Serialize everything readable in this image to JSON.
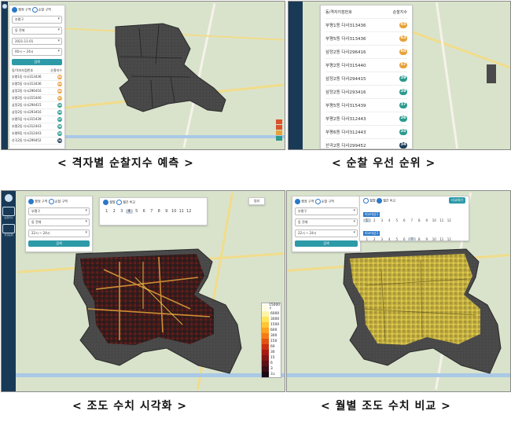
{
  "captions": {
    "top_left": "< 격자별 순찰지수 예측 >",
    "top_right": "< 순찰 우선 순위 >",
    "bottom_left": "< 조도 수치 시각화 >",
    "bottom_right": "< 월별 조도 수치 비교 >"
  },
  "sidebar": {
    "items": [
      {
        "icon": "bell-icon",
        "label": "순찰지수"
      },
      {
        "icon": "edit-icon",
        "label": "우선순위"
      }
    ]
  },
  "panel1": {
    "radio_admin": "행정 구역",
    "radio_patrol": "순찰 구역",
    "select_district": "부평구",
    "select_dong": "동 전체",
    "select_date": "2021-11-01",
    "select_time": "00시 ~ 24시",
    "search_button": "검색",
    "table_header_left": "동/격자지점번호",
    "table_header_right": "순찰지수",
    "rows": [
      {
        "name": "부평1동 다사313436",
        "score": "65",
        "color": "#e8a23a"
      },
      {
        "name": "부평5동 다사313436",
        "score": "63",
        "color": "#e8a23a"
      },
      {
        "name": "삼정2동 다사296416",
        "score": "60",
        "color": "#e8a23a"
      },
      {
        "name": "부평2동 다사315440",
        "score": "57",
        "color": "#e8a23a"
      },
      {
        "name": "삼정2동 다사294415",
        "score": "39",
        "color": "#2b9a8e"
      },
      {
        "name": "삼정2동 다사293416",
        "score": "39",
        "color": "#2b9a8e"
      },
      {
        "name": "부평5동 다사315439",
        "score": "37",
        "color": "#2b9a8e"
      },
      {
        "name": "부평2동 다사312443",
        "score": "36",
        "color": "#2b9a8e"
      },
      {
        "name": "부평6동 다사312443",
        "score": "35",
        "color": "#2b9a8e"
      },
      {
        "name": "산곡2동 다사299452",
        "score": "34",
        "color": "#1e3e5a"
      }
    ]
  },
  "panel2": {
    "table_header_left": "동/격자지점번호",
    "table_header_right": "순찰지수",
    "rows": [
      {
        "name": "부평1동 다사313436",
        "score": "65",
        "color": "#e8a23a"
      },
      {
        "name": "부평5동 다사313436",
        "score": "63",
        "color": "#e8a23a"
      },
      {
        "name": "삼정2동 다사296416",
        "score": "60",
        "color": "#e8a23a"
      },
      {
        "name": "부평2동 다사315440",
        "score": "57",
        "color": "#e8a23a"
      },
      {
        "name": "삼정2동 다사294415",
        "score": "39",
        "color": "#2b9a8e"
      },
      {
        "name": "삼정2동 다사293416",
        "score": "39",
        "color": "#2b9a8e"
      },
      {
        "name": "부평5동 다사315439",
        "score": "37",
        "color": "#2b9a8e"
      },
      {
        "name": "부평2동 다사312443",
        "score": "36",
        "color": "#2b9a8e"
      },
      {
        "name": "부평6동 다사312443",
        "score": "35",
        "color": "#2b9a8e"
      },
      {
        "name": "산곡2동 다사299452",
        "score": "34",
        "color": "#1e3e5a"
      }
    ]
  },
  "panel3": {
    "radio_admin": "행정 구역",
    "radio_patrol": "순찰 구역",
    "select_district": "부평구",
    "select_dong": "동 전체",
    "select_time": "22시 ~ 24시",
    "search_button": "검색",
    "radio_single": "월별",
    "radio_compare": "월간 비교",
    "months": [
      "1",
      "2",
      "3",
      "4",
      "5",
      "6",
      "7",
      "8",
      "9",
      "10",
      "11",
      "12"
    ],
    "selected_month": "4",
    "top_right_button": "범리",
    "legend": [
      {
        "label": "15000 ↑",
        "color": "#fffbe0"
      },
      {
        "label": "6000",
        "color": "#fff3a8"
      },
      {
        "label": "3000",
        "color": "#ffe45c"
      },
      {
        "label": "1500",
        "color": "#ffc533"
      },
      {
        "label": "600",
        "color": "#ffa21f"
      },
      {
        "label": "300",
        "color": "#f47b16"
      },
      {
        "label": "150",
        "color": "#e25312"
      },
      {
        "label": "60",
        "color": "#c9300f"
      },
      {
        "label": "30",
        "color": "#a81a12"
      },
      {
        "label": "15",
        "color": "#821414"
      },
      {
        "label": "6",
        "color": "#5c1216"
      },
      {
        "label": "3",
        "color": "#3a0f17"
      },
      {
        "label": "3↓",
        "color": "#180912"
      }
    ]
  },
  "panel4": {
    "radio_admin": "행정 구역",
    "radio_patrol": "순찰 구역",
    "select_district": "부평구",
    "select_dong": "동 전체",
    "select_time": "22시 ~ 24시",
    "search_button": "검색",
    "radio_single": "월별",
    "radio_compare": "월간 비교",
    "compare_label_1": "비교대상1",
    "compare_label_2": "비교대상2",
    "compare_button": "비교하기",
    "months": [
      "1",
      "2",
      "3",
      "4",
      "5",
      "6",
      "7",
      "8",
      "9",
      "10",
      "11",
      "12"
    ],
    "selected_month_1": "1",
    "selected_month_2": "7"
  },
  "colors": {
    "sidebar": "#183a56",
    "accent": "#2d9aa8",
    "grid_dark": "#4b4b4b",
    "frame": "#8a8a8a"
  }
}
